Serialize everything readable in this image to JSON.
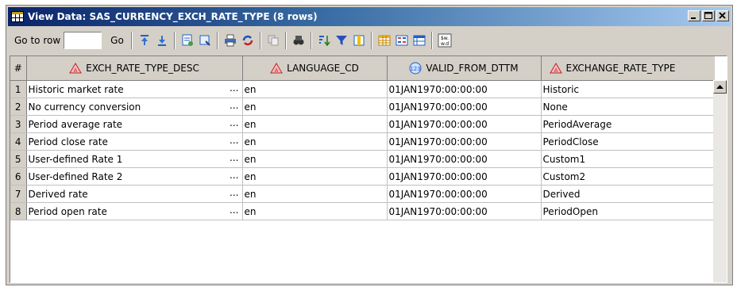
{
  "window": {
    "title": "View Data: SAS_CURRENCY_EXCH_RATE_TYPE (8 rows)",
    "controls": [
      "minimize",
      "maximize",
      "close"
    ]
  },
  "toolbar": {
    "goto_label": "Go to row",
    "goto_value": "",
    "go_button": "Go",
    "icons": [
      "move-to-top-icon",
      "move-to-bottom-icon",
      "properties-icon",
      "query-icon",
      "print-icon",
      "refresh-icon",
      "copy-icon",
      "find-icon",
      "sort-icon",
      "filter-icon",
      "columns-icon",
      "table-view-icon",
      "form-view-icon",
      "layout-icon",
      "format-icon"
    ]
  },
  "table": {
    "columns": [
      {
        "label": "#",
        "icon": ""
      },
      {
        "label": "EXCH_RATE_TYPE_DESC",
        "icon": "character-type-icon"
      },
      {
        "label": "LANGUAGE_CD",
        "icon": "character-type-icon"
      },
      {
        "label": "VALID_FROM_DTTM",
        "icon": "numeric-type-icon"
      },
      {
        "label": "EXCHANGE_RATE_TYPE",
        "icon": "character-type-icon"
      }
    ],
    "rows": [
      {
        "num": "1",
        "desc": "Historic market rate",
        "ellipsis": "...",
        "lang": "en",
        "dttm": "01JAN1970:00:00:00",
        "type": "Historic"
      },
      {
        "num": "2",
        "desc": "No currency conversion",
        "ellipsis": "...",
        "lang": "en",
        "dttm": "01JAN1970:00:00:00",
        "type": "None"
      },
      {
        "num": "3",
        "desc": "Period average rate",
        "ellipsis": "...",
        "lang": "en",
        "dttm": "01JAN1970:00:00:00",
        "type": "PeriodAverage"
      },
      {
        "num": "4",
        "desc": "Period close rate",
        "ellipsis": "...",
        "lang": "en",
        "dttm": "01JAN1970:00:00:00",
        "type": "PeriodClose"
      },
      {
        "num": "5",
        "desc": "User-defined Rate 1",
        "ellipsis": "...",
        "lang": "en",
        "dttm": "01JAN1970:00:00:00",
        "type": "Custom1"
      },
      {
        "num": "6",
        "desc": "User-defined Rate 2",
        "ellipsis": "...",
        "lang": "en",
        "dttm": "01JAN1970:00:00:00",
        "type": "Custom2"
      },
      {
        "num": "7",
        "desc": "Derived rate",
        "ellipsis": "...",
        "lang": "en",
        "dttm": "01JAN1970:00:00:00",
        "type": "Derived"
      },
      {
        "num": "8",
        "desc": "Period open rate",
        "ellipsis": "...",
        "lang": "en",
        "dttm": "01JAN1970:00:00:00",
        "type": "PeriodOpen"
      }
    ]
  }
}
